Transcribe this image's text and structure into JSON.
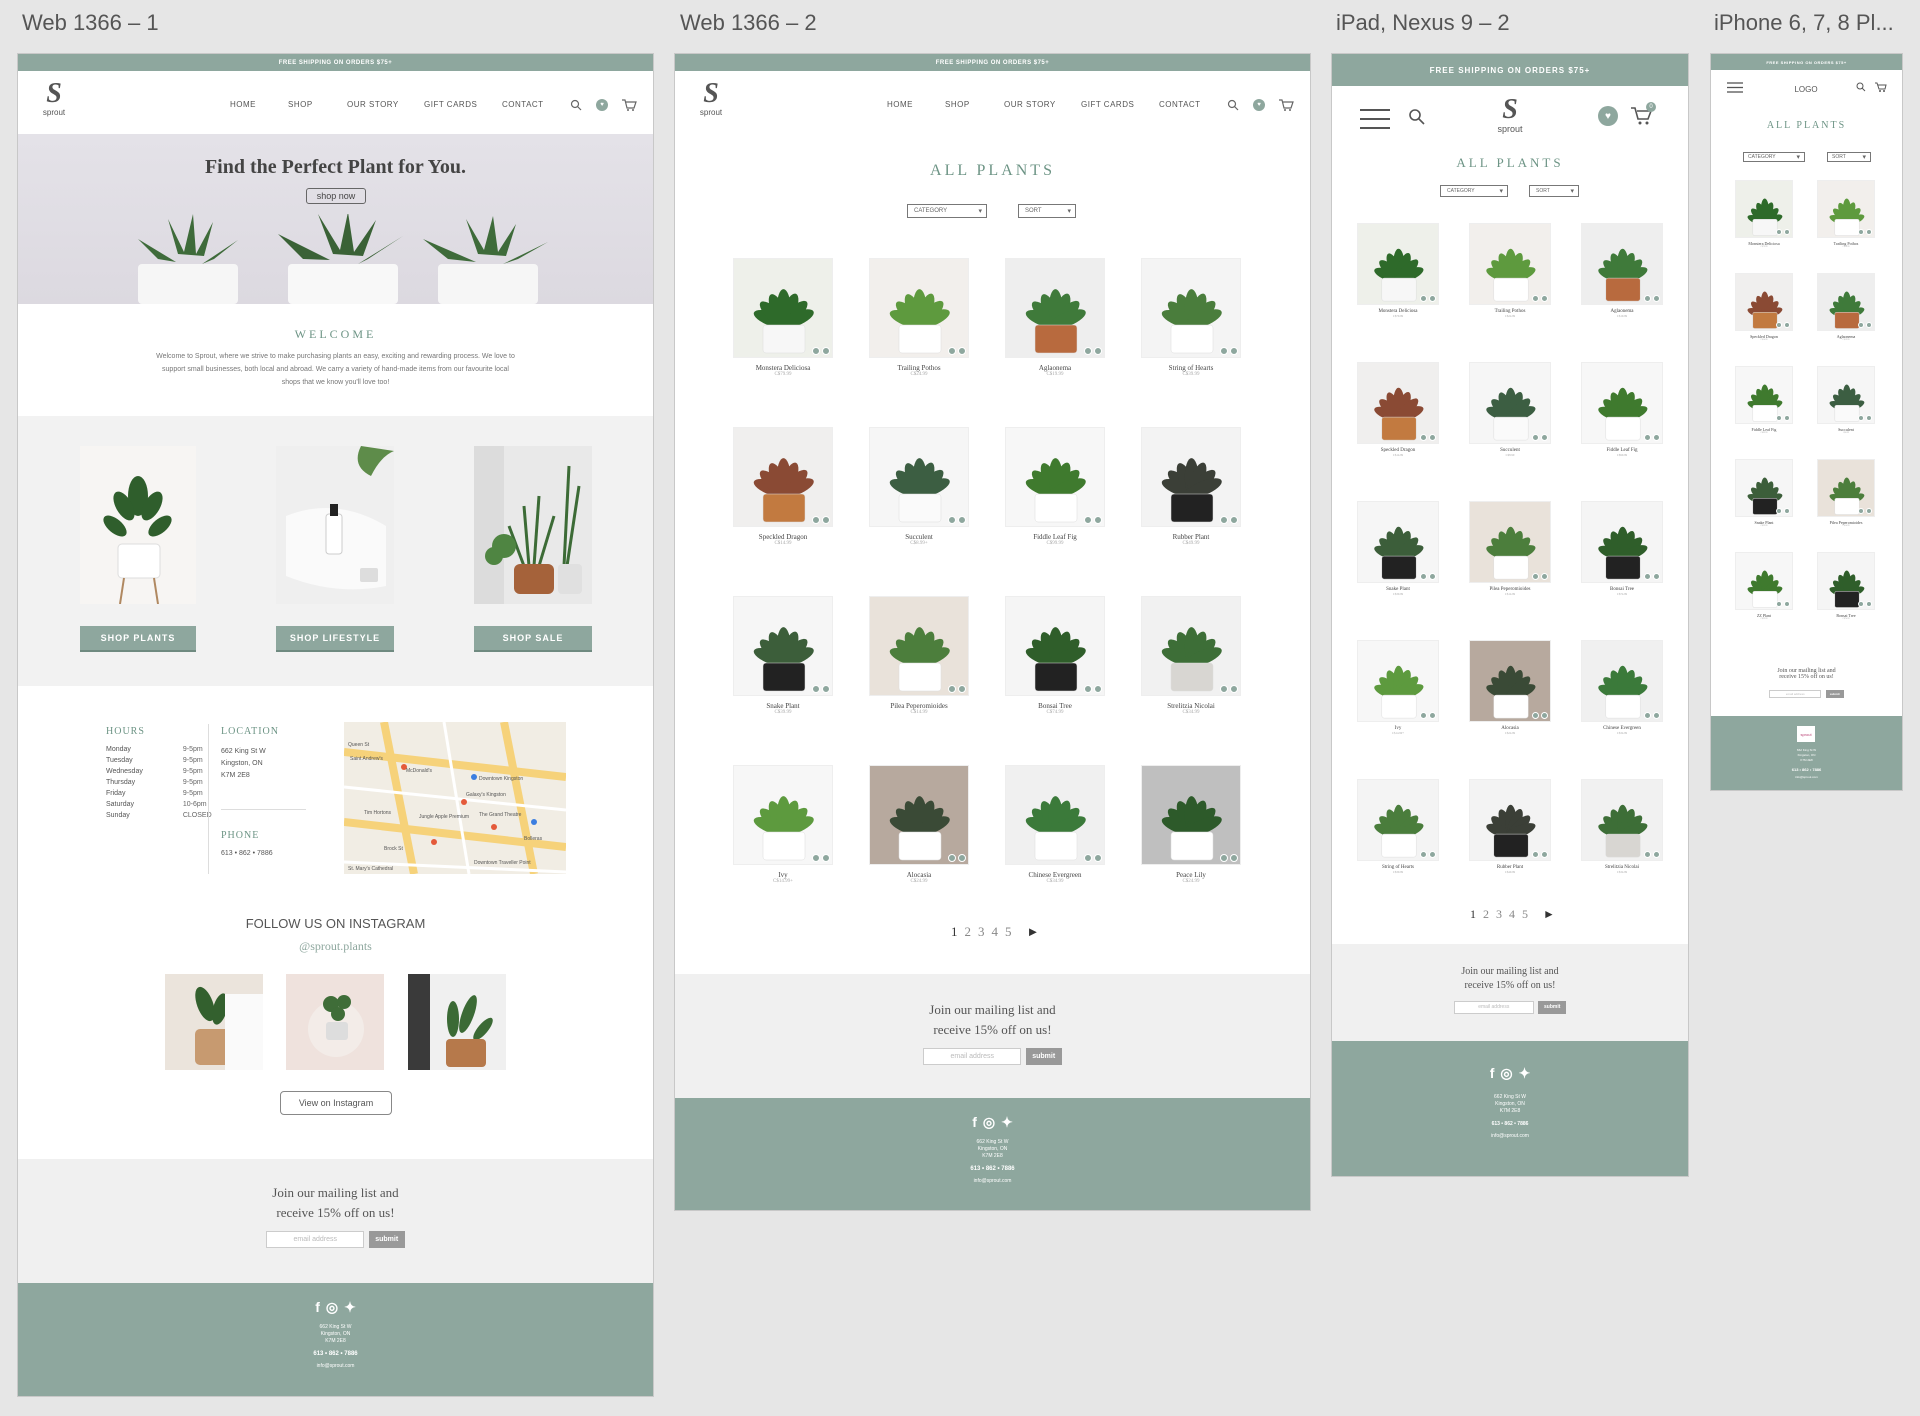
{
  "boards": [
    "Web 1366 – 1",
    "Web 1366 – 2",
    "iPad, Nexus 9 – 2",
    "iPhone 6, 7, 8 Pl..."
  ],
  "banner": "FREE SHIPPING ON ORDERS $75+",
  "brand": {
    "mark": "S",
    "name": "sprout"
  },
  "nav": [
    "HOME",
    "SHOP",
    "OUR STORY",
    "GIFT CARDS",
    "CONTACT"
  ],
  "cart_count": "0",
  "home": {
    "hero_title": "Find the Perfect Plant for You.",
    "hero_button": "shop now",
    "welcome_title": "WELCOME",
    "welcome_text": "Welcome to Sprout, where we strive to make purchasing plants an easy, exciting and rewarding process. We love to support small businesses, both local and abroad. We carry a variety of hand-made items from our favourite local shops that we know you'll love too!",
    "cat_buttons": [
      "SHOP PLANTS",
      "SHOP LIFESTYLE",
      "SHOP SALE"
    ],
    "hours_title": "HOURS",
    "hours": [
      [
        "Monday",
        "9-5pm"
      ],
      [
        "Tuesday",
        "9-5pm"
      ],
      [
        "Wednesday",
        "9-5pm"
      ],
      [
        "Thursday",
        "9-5pm"
      ],
      [
        "Friday",
        "9-5pm"
      ],
      [
        "Saturday",
        "10-6pm"
      ],
      [
        "Sunday",
        "CLOSED"
      ]
    ],
    "location_title": "LOCATION",
    "address": [
      "662 King St W",
      "Kingston, ON",
      "K7M 2E8"
    ],
    "phone_title": "PHONE",
    "phone": "613 • 862 • 7886",
    "map_labels": [
      "Queen St",
      "Saint Andrew's",
      "McDonald's",
      "Downtown Kingston",
      "Galaxy's Kingston",
      "Tim Hortons",
      "Jungle Apple Premium",
      "The Grand Theatre",
      "Bolleras",
      "Downtown Traveller Point",
      "St. Mary's Cathedral",
      "Brock St"
    ],
    "insta_title": "FOLLOW US ON INSTAGRAM",
    "insta_handle": "@sprout.plants",
    "insta_button": "View on Instagram"
  },
  "shop": {
    "title": "ALL PLANTS",
    "category": "CATEGORY",
    "sort": "SORT",
    "products": [
      {
        "name": "Monstera Deliciosa",
        "price": "C$79.99"
      },
      {
        "name": "Trailing Pothos",
        "price": "C$24.99"
      },
      {
        "name": "Aglaonema",
        "price": "C$19.99"
      },
      {
        "name": "String of Hearts",
        "price": "C$39.99"
      },
      {
        "name": "Speckled Dragon",
        "price": "C$14.99"
      },
      {
        "name": "Succulent",
        "price": "C$8.99+"
      },
      {
        "name": "Fiddle Leaf Fig",
        "price": "C$99.99"
      },
      {
        "name": "Rubber Plant",
        "price": "C$49.99"
      },
      {
        "name": "Snake Plant",
        "price": "C$39.99"
      },
      {
        "name": "Pilea Peperomioides",
        "price": "C$14.99"
      },
      {
        "name": "Bonsai Tree",
        "price": "C$74.99"
      },
      {
        "name": "Strelitzia Nicolai",
        "price": "C$34.99"
      },
      {
        "name": "Ivy",
        "price": "C$14.99+"
      },
      {
        "name": "Alocasia",
        "price": "C$24.99"
      },
      {
        "name": "Chinese Evergreen",
        "price": "C$34.99"
      },
      {
        "name": "Peace Lily",
        "price": "C$24.99"
      }
    ],
    "ipad_products": [
      {
        "name": "Monstera Deliciosa",
        "price": "C$79.99"
      },
      {
        "name": "Trailing Pothos",
        "price": "C$24.99"
      },
      {
        "name": "Aglaonema",
        "price": "C$19.99"
      },
      {
        "name": "Speckled Dragon",
        "price": "C$14.99"
      },
      {
        "name": "Succulent",
        "price": "C$8.99"
      },
      {
        "name": "Fiddle Leaf Fig",
        "price": "C$99.99"
      },
      {
        "name": "Snake Plant",
        "price": "C$39.99"
      },
      {
        "name": "Pilea Peperomioides",
        "price": "C$14.99"
      },
      {
        "name": "Bonsai Tree",
        "price": "C$74.99"
      },
      {
        "name": "Ivy",
        "price": "C$14.99+"
      },
      {
        "name": "Alocasia",
        "price": "C$24.99"
      },
      {
        "name": "Chinese Evergreen",
        "price": "C$34.99"
      },
      {
        "name": "String of Hearts",
        "price": "C$39.99"
      },
      {
        "name": "Rubber Plant",
        "price": "C$49.99"
      },
      {
        "name": "Strelitzia Nicolai",
        "price": "C$34.99"
      }
    ],
    "iphone_products": [
      {
        "name": "Monstera Deliciosa",
        "price": "C$79.99"
      },
      {
        "name": "Trailing Pothos",
        "price": "C$24.99"
      },
      {
        "name": "Speckled Dragon",
        "price": "C$14.99"
      },
      {
        "name": "Aglaonema",
        "price": "C$19.99"
      },
      {
        "name": "Fiddle Leaf Fig",
        "price": "C$99.99"
      },
      {
        "name": "Succulent",
        "price": "C$8.99"
      },
      {
        "name": "Snake Plant",
        "price": "C$39.99"
      },
      {
        "name": "Pilea Peperomioides",
        "price": "C$14.99"
      },
      {
        "name": "ZZ Plant",
        "price": "C$29.99"
      },
      {
        "name": "Bonsai Tree",
        "price": "C$74.99"
      }
    ],
    "pages": [
      "1",
      "2",
      "3",
      "4",
      "5"
    ],
    "next": "►"
  },
  "iphone_logo": "LOGO",
  "mailing": {
    "line1": "Join our mailing list and",
    "line2": "receive 15% off on us!",
    "placeholder": "email address",
    "button": "submit"
  },
  "footer": {
    "address": [
      "662 King St W",
      "Kingston, ON",
      "K7M 2E8"
    ],
    "phone": "613 • 862 • 7886",
    "email": "info@sprout.com"
  },
  "social_icons": [
    "facebook-icon",
    "instagram-icon",
    "twitter-icon"
  ],
  "colors": {
    "sage": "#8ea79e",
    "title_green": "#6d9485",
    "bg": "#e6e6e6"
  }
}
